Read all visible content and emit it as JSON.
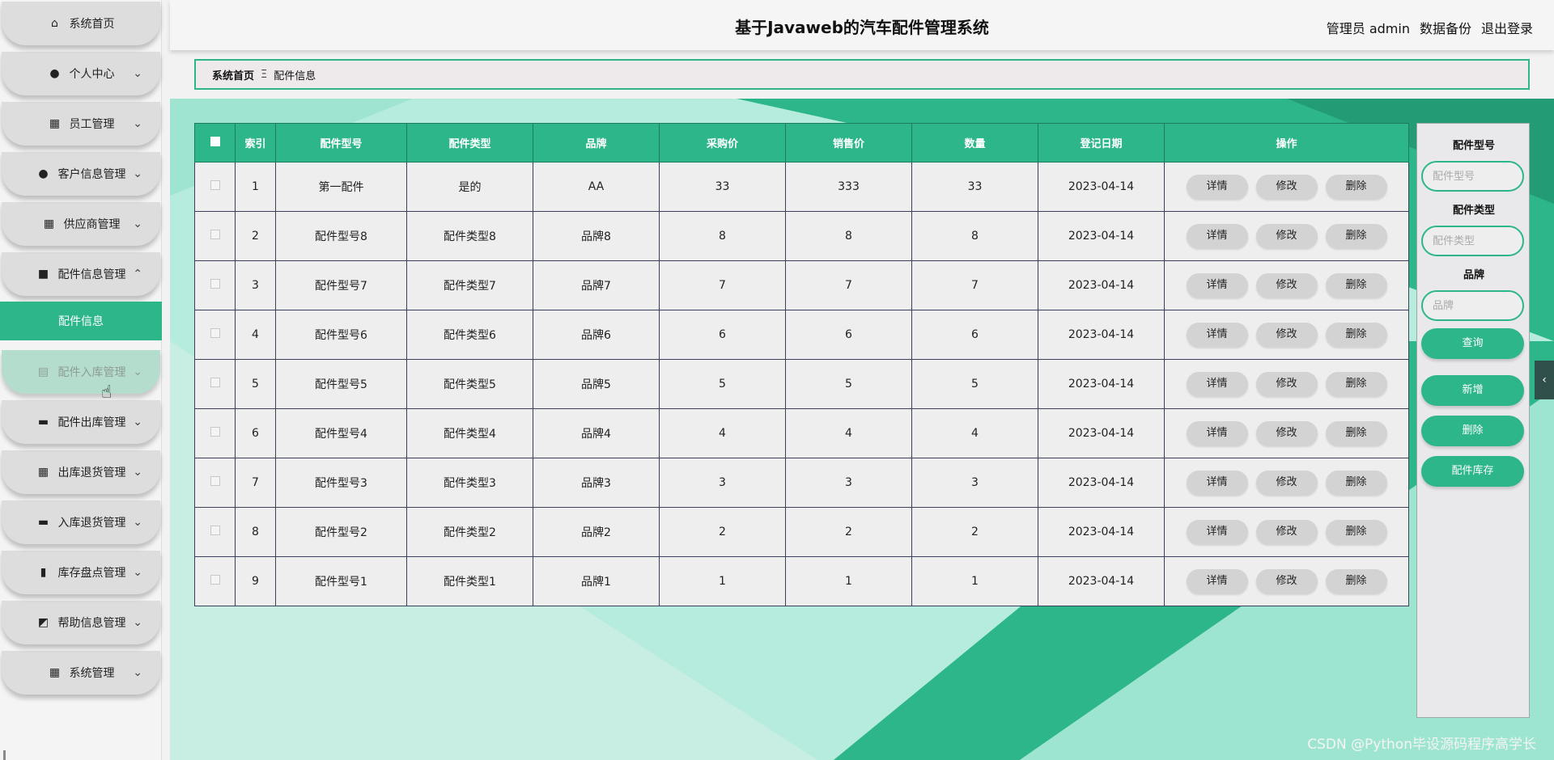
{
  "header": {
    "title": "基于Javaweb的汽车配件管理系统",
    "user": "管理员 admin",
    "backup": "数据备份",
    "logout": "退出登录"
  },
  "sidebar": {
    "items": [
      {
        "label": "系统首页",
        "icon": "home-icon",
        "glyph": "⌂",
        "chevron": false
      },
      {
        "label": "个人中心",
        "icon": "person-icon",
        "glyph": "●",
        "chevron": true
      },
      {
        "label": "员工管理",
        "icon": "grid-icon",
        "glyph": "▦",
        "chevron": true
      },
      {
        "label": "客户信息管理",
        "icon": "pin-icon",
        "glyph": "●",
        "chevron": true
      },
      {
        "label": "供应商管理",
        "icon": "apps-icon",
        "glyph": "▦",
        "chevron": true
      },
      {
        "label": "配件信息管理",
        "icon": "book-icon",
        "glyph": "■",
        "chevron": true,
        "expanded": true
      },
      {
        "label": "配件入库管理",
        "icon": "clipboard-icon",
        "glyph": "▤",
        "chevron": true
      },
      {
        "label": "配件出库管理",
        "icon": "briefcase-icon",
        "glyph": "▬",
        "chevron": true
      },
      {
        "label": "出库退货管理",
        "icon": "apps-icon",
        "glyph": "▦",
        "chevron": true
      },
      {
        "label": "入库退货管理",
        "icon": "bus-icon",
        "glyph": "▬",
        "chevron": true
      },
      {
        "label": "库存盘点管理",
        "icon": "bar-chart-icon",
        "glyph": "▮",
        "chevron": true
      },
      {
        "label": "帮助信息管理",
        "icon": "line-chart-icon",
        "glyph": "◩",
        "chevron": true
      },
      {
        "label": "系统管理",
        "icon": "apps-icon",
        "glyph": "▦",
        "chevron": true
      }
    ],
    "submenu_label": "配件信息"
  },
  "breadcrumb": {
    "home": "系统首页",
    "separator": "Ξ",
    "current": "配件信息"
  },
  "table": {
    "columns": [
      "索引",
      "配件型号",
      "配件类型",
      "品牌",
      "采购价",
      "销售价",
      "数量",
      "登记日期",
      "操作"
    ],
    "rows": [
      {
        "index": "1",
        "model": "第一配件",
        "type": "是的",
        "brand": "AA",
        "purchase": "33",
        "sale": "333",
        "qty": "33",
        "date": "2023-04-14"
      },
      {
        "index": "2",
        "model": "配件型号8",
        "type": "配件类型8",
        "brand": "品牌8",
        "purchase": "8",
        "sale": "8",
        "qty": "8",
        "date": "2023-04-14"
      },
      {
        "index": "3",
        "model": "配件型号7",
        "type": "配件类型7",
        "brand": "品牌7",
        "purchase": "7",
        "sale": "7",
        "qty": "7",
        "date": "2023-04-14"
      },
      {
        "index": "4",
        "model": "配件型号6",
        "type": "配件类型6",
        "brand": "品牌6",
        "purchase": "6",
        "sale": "6",
        "qty": "6",
        "date": "2023-04-14"
      },
      {
        "index": "5",
        "model": "配件型号5",
        "type": "配件类型5",
        "brand": "品牌5",
        "purchase": "5",
        "sale": "5",
        "qty": "5",
        "date": "2023-04-14"
      },
      {
        "index": "6",
        "model": "配件型号4",
        "type": "配件类型4",
        "brand": "品牌4",
        "purchase": "4",
        "sale": "4",
        "qty": "4",
        "date": "2023-04-14"
      },
      {
        "index": "7",
        "model": "配件型号3",
        "type": "配件类型3",
        "brand": "品牌3",
        "purchase": "3",
        "sale": "3",
        "qty": "3",
        "date": "2023-04-14"
      },
      {
        "index": "8",
        "model": "配件型号2",
        "type": "配件类型2",
        "brand": "品牌2",
        "purchase": "2",
        "sale": "2",
        "qty": "2",
        "date": "2023-04-14"
      },
      {
        "index": "9",
        "model": "配件型号1",
        "type": "配件类型1",
        "brand": "品牌1",
        "purchase": "1",
        "sale": "1",
        "qty": "1",
        "date": "2023-04-14"
      }
    ],
    "actions": {
      "detail": "详情",
      "edit": "修改",
      "delete": "删除"
    }
  },
  "search": {
    "model_label": "配件型号",
    "model_placeholder": "配件型号",
    "model_value": "",
    "type_label": "配件类型",
    "type_placeholder": "配件类型",
    "type_value": "",
    "brand_label": "品牌",
    "brand_placeholder": "品牌",
    "brand_value": "",
    "query_button": "查询",
    "add_button": "新增",
    "delete_button": "删除",
    "stock_button": "配件库存"
  },
  "side_toggle_glyph": "‹",
  "watermark": "CSDN @Python毕设源码程序高学长",
  "colors": {
    "accent": "#2db68a",
    "bg_light": "#b4ecdc"
  }
}
